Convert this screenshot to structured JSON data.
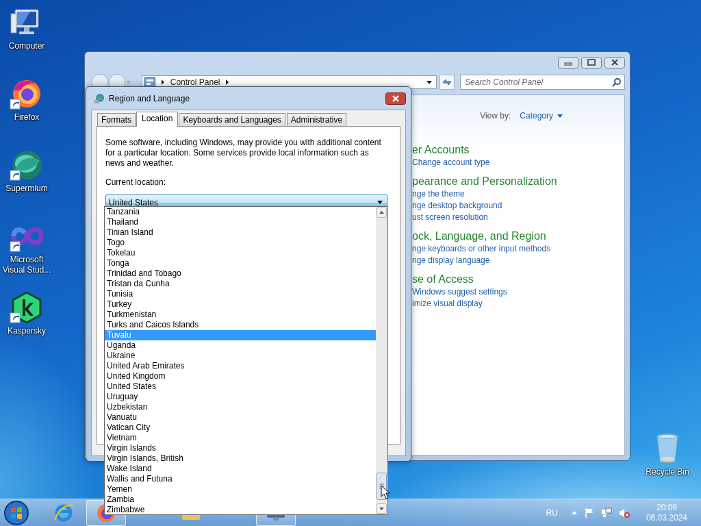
{
  "desktop_icons": [
    {
      "label": "Computer",
      "kind": "computer",
      "shortcut": false
    },
    {
      "label": "Firefox",
      "kind": "firefox",
      "shortcut": true
    },
    {
      "label": "Supermium",
      "kind": "sphere",
      "shortcut": true
    },
    {
      "label": "Microsoft Visual Stud...",
      "kind": "infinity",
      "shortcut": true
    },
    {
      "label": "Kaspersky",
      "kind": "hexagon",
      "shortcut": true
    }
  ],
  "recycle_bin": {
    "label": "Recycle Bin"
  },
  "control_panel": {
    "address": [
      "Control Panel"
    ],
    "search": {
      "placeholder": "Search Control Panel"
    },
    "view_by": {
      "label": "View by:",
      "value": "Category"
    },
    "categories": [
      {
        "title": "er Accounts",
        "links": [
          "Change account type"
        ]
      },
      {
        "title": "pearance and Personalization",
        "links": [
          "nge the theme",
          "nge desktop background",
          "ust screen resolution"
        ]
      },
      {
        "title": "ock, Language, and Region",
        "links": [
          "nge keyboards or other input methods",
          "nge display language"
        ]
      },
      {
        "title": "se of Access",
        "links": [
          "Windows suggest settings",
          "imize visual display"
        ]
      }
    ]
  },
  "dialog": {
    "title": "Region and Language",
    "tabs": [
      {
        "label": "Formats",
        "selected": false
      },
      {
        "label": "Location",
        "selected": true
      },
      {
        "label": "Keyboards and Languages",
        "selected": false
      },
      {
        "label": "Administrative",
        "selected": false
      }
    ],
    "description": "Some software, including Windows, may provide you with additional content for a particular location. Some services provide local information such as news and weather.",
    "location_label": "Current location:",
    "location": {
      "value": "United States",
      "expanded": true
    },
    "options": [
      {
        "label": "Tanzania",
        "selected": false
      },
      {
        "label": "Thailand",
        "selected": false
      },
      {
        "label": "Tinian Island",
        "selected": false
      },
      {
        "label": "Togo",
        "selected": false
      },
      {
        "label": "Tokelau",
        "selected": false
      },
      {
        "label": "Tonga",
        "selected": false
      },
      {
        "label": "Trinidad and Tobago",
        "selected": false
      },
      {
        "label": "Tristan da Cunha",
        "selected": false
      },
      {
        "label": "Tunisia",
        "selected": false
      },
      {
        "label": "Turkey",
        "selected": false
      },
      {
        "label": "Turkmenistan",
        "selected": false
      },
      {
        "label": "Turks and Caicos Islands",
        "selected": false
      },
      {
        "label": "Tuvalu",
        "selected": true
      },
      {
        "label": "Uganda",
        "selected": false
      },
      {
        "label": "Ukraine",
        "selected": false
      },
      {
        "label": "United Arab Emirates",
        "selected": false
      },
      {
        "label": "United Kingdom",
        "selected": false
      },
      {
        "label": "United States",
        "selected": false
      },
      {
        "label": "Uruguay",
        "selected": false
      },
      {
        "label": "Uzbekistan",
        "selected": false
      },
      {
        "label": "Vanuatu",
        "selected": false
      },
      {
        "label": "Vatican City",
        "selected": false
      },
      {
        "label": "Vietnam",
        "selected": false
      },
      {
        "label": "Virgin Islands",
        "selected": false
      },
      {
        "label": "Virgin Islands, British",
        "selected": false
      },
      {
        "label": "Wake Island",
        "selected": false
      },
      {
        "label": "Wallis and Futuna",
        "selected": false
      },
      {
        "label": "Yemen",
        "selected": false
      },
      {
        "label": "Zambia",
        "selected": false
      },
      {
        "label": "Zimbabwe",
        "selected": false
      }
    ]
  },
  "taskbar": {
    "items": [
      {
        "kind": "ie",
        "running": false
      },
      {
        "kind": "firefox",
        "running": true
      },
      {
        "kind": "folder",
        "running": false
      },
      {
        "kind": "monitor",
        "running": true
      }
    ],
    "tray": {
      "language": "RU",
      "muted": true,
      "time": "20:09",
      "date": "06.03.2024"
    }
  }
}
